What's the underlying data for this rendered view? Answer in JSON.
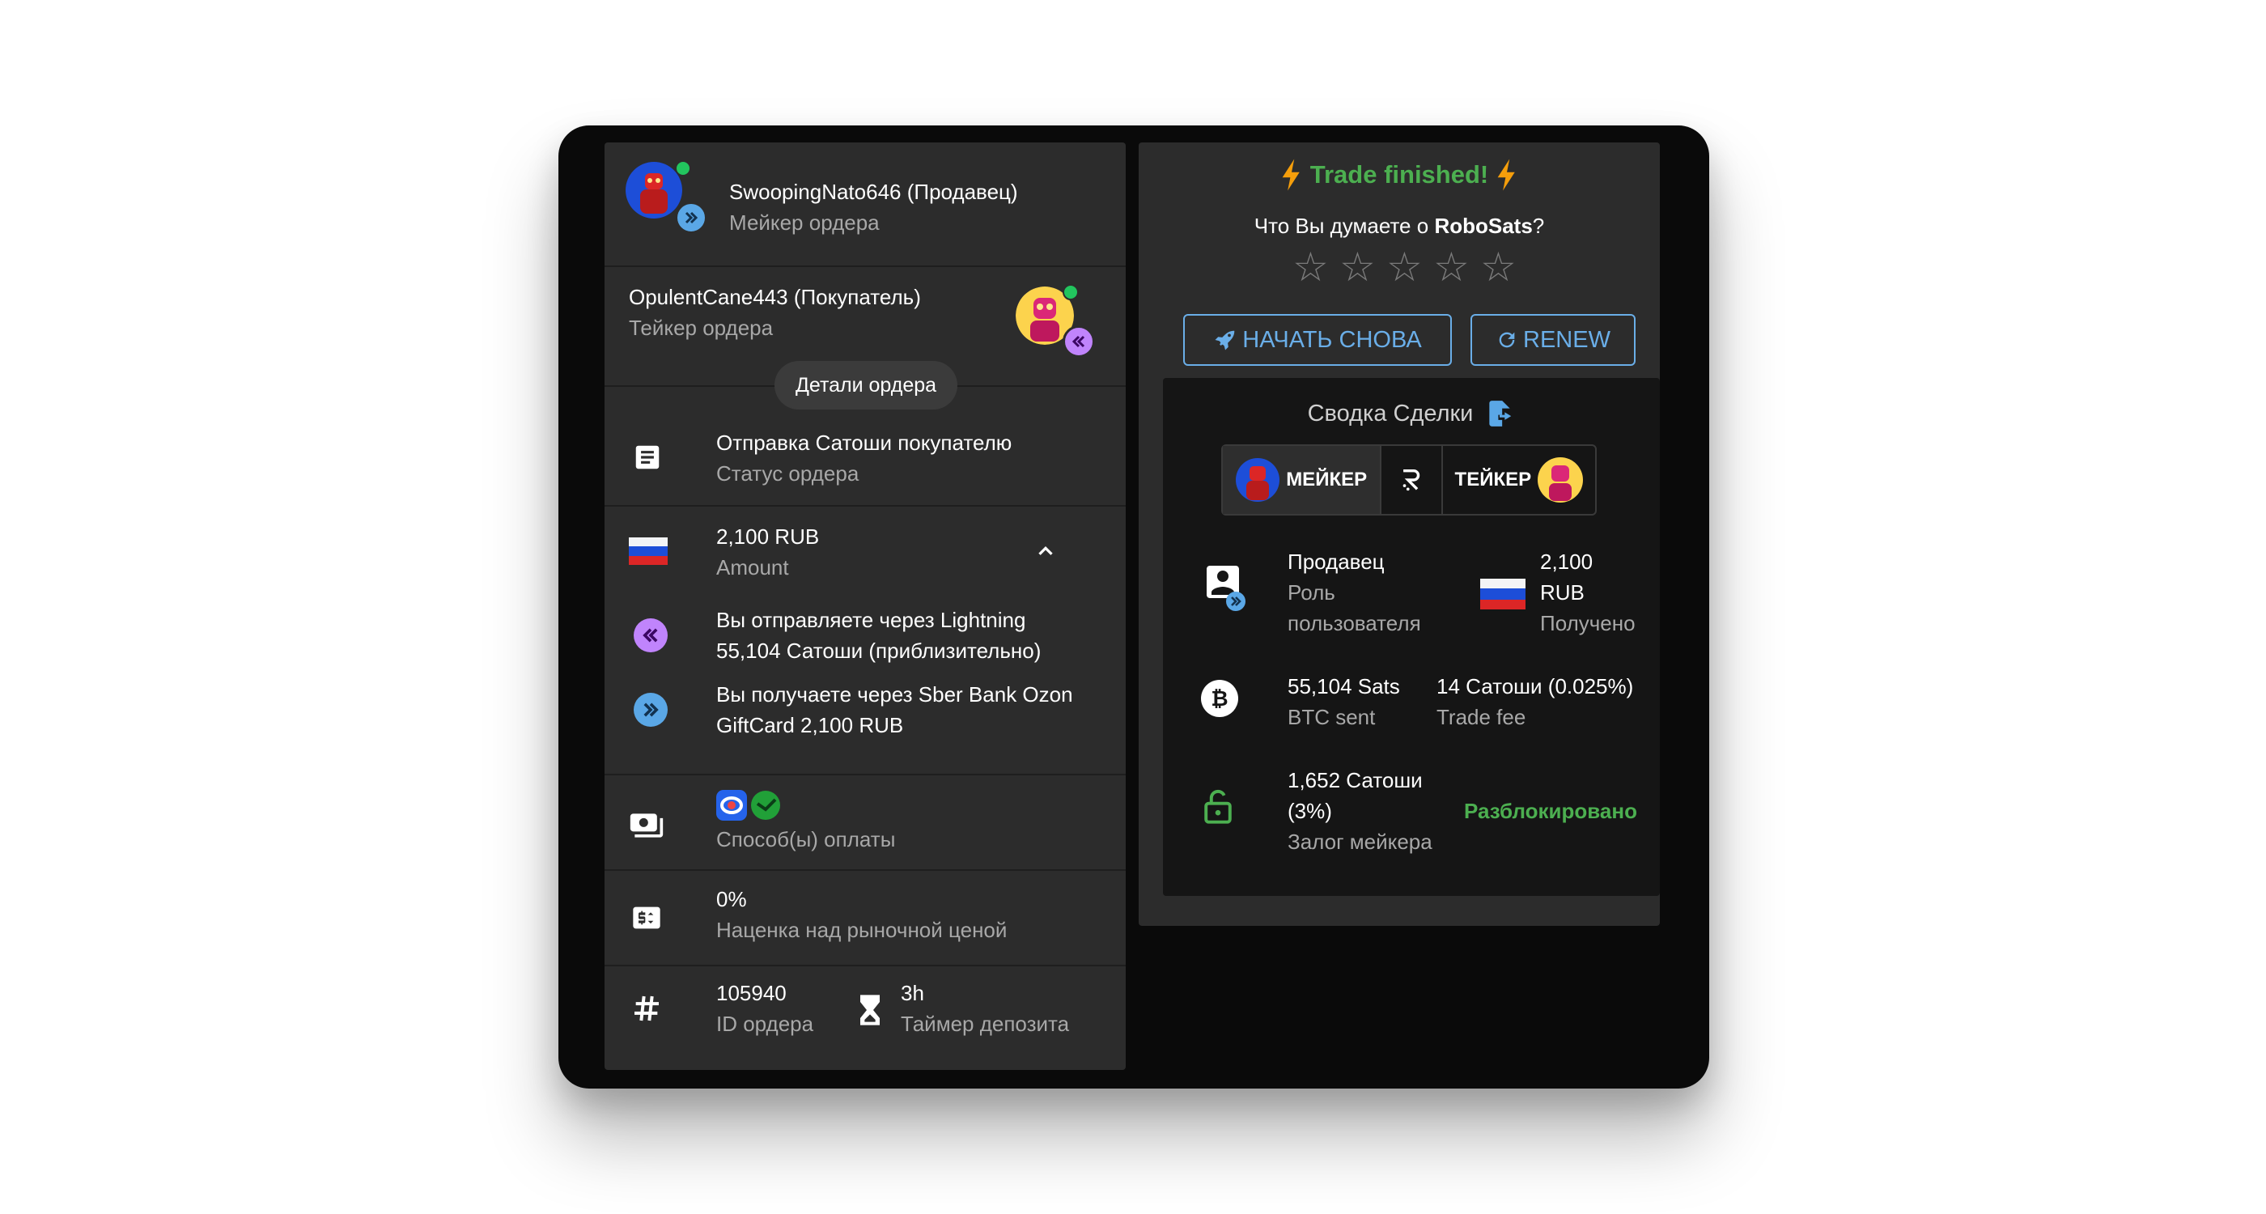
{
  "left": {
    "maker": {
      "name": "SwoopingNato646 (Продавец)",
      "role": "Мейкер ордера"
    },
    "taker": {
      "name": "OpulentCane443 (Покупатель)",
      "role": "Тейкер ордера"
    },
    "details_chip": "Детали ордера",
    "status": {
      "value": "Отправка Сатоши покупателю",
      "label": "Статус ордера"
    },
    "amount": {
      "value": "2,100 RUB",
      "label": "Amount"
    },
    "send": {
      "line1": "Вы отправляете через Lightning",
      "line2": "55,104 Сатоши (приблизительно)"
    },
    "receive": {
      "line1": "Вы получаете через Sber Bank Ozon",
      "line2": "GiftCard 2,100 RUB"
    },
    "payment": {
      "label": "Способ(ы) оплаты"
    },
    "premium": {
      "value": "0%",
      "label": "Наценка над рыночной ценой"
    },
    "order_id": {
      "value": "105940",
      "label": "ID ордера"
    },
    "timer": {
      "value": "3h",
      "label": "Таймер депозита"
    }
  },
  "right": {
    "title": "Trade finished!",
    "rating_prompt_prefix": "Что Вы думаете о ",
    "rating_prompt_brand": "RoboSats",
    "rating_prompt_suffix": "?",
    "rating": {
      "stars": 5,
      "selected": 0
    },
    "btn_restart": "НАЧАТЬ СНОВА",
    "btn_renew": "RENEW",
    "summary": {
      "title": "Сводка Сделки",
      "maker_label": "МЕЙКЕР",
      "taker_label": "ТЕЙКЕР",
      "role_value": "Продавец",
      "role_label_1": "Роль",
      "role_label_2": "пользователя",
      "received_value_1": "2,100",
      "received_value_2": "RUB",
      "received_label": "Получено",
      "btc_sent_value": "55,104 Sats",
      "btc_sent_label": "BTC sent",
      "fee_value": "14 Сатоши (0.025%)",
      "fee_label": "Trade fee",
      "bond_value_1": "1,652 Сатоши",
      "bond_value_2": "(3%)",
      "bond_label": "Залог мейкера",
      "bond_status": "Разблокировано"
    }
  },
  "colors": {
    "accent_blue": "#6aaee8",
    "success_green": "#4caf50",
    "bolt_orange": "#f59e0b",
    "maker_badge": "#5aa7e6",
    "taker_badge": "#a855f7"
  },
  "icons": [
    "lightning-icon",
    "star-icon",
    "rocket-icon",
    "refresh-icon",
    "export-icon",
    "account-box-icon",
    "bitcoin-icon",
    "lock-open-icon",
    "hash-icon",
    "hourglass-icon",
    "payments-icon",
    "price-tag-icon",
    "order-status-icon",
    "chevron-up-icon",
    "russia-flag-icon"
  ]
}
